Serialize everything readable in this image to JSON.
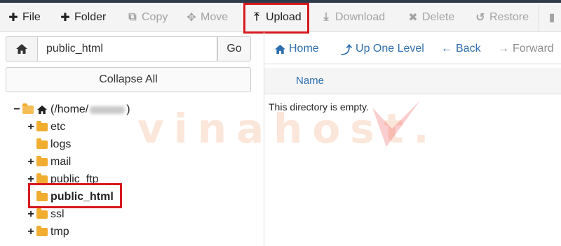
{
  "toolbar": {
    "file": "File",
    "folder": "Folder",
    "copy": "Copy",
    "move": "Move",
    "upload": "Upload",
    "download": "Download",
    "delete": "Delete",
    "restore": "Restore"
  },
  "path_bar": {
    "value": "public_html",
    "go": "Go"
  },
  "collapse_all": "Collapse All",
  "tree": {
    "root_prefix": "(/home/",
    "root_suffix": ")",
    "items": [
      {
        "label": "etc"
      },
      {
        "label": "logs"
      },
      {
        "label": "mail"
      },
      {
        "label": "public_ftp"
      },
      {
        "label": "public_html"
      },
      {
        "label": "ssl"
      },
      {
        "label": "tmp"
      }
    ]
  },
  "nav": {
    "home": "Home",
    "up": "Up One Level",
    "back": "Back",
    "forward": "Forward"
  },
  "list": {
    "col_name": "Name",
    "empty": "This directory is empty."
  },
  "watermark": "vinahost.",
  "colors": {
    "highlight": "#d7191f",
    "link_blue": "#2f6fb0",
    "folder": "#f0ad30"
  }
}
